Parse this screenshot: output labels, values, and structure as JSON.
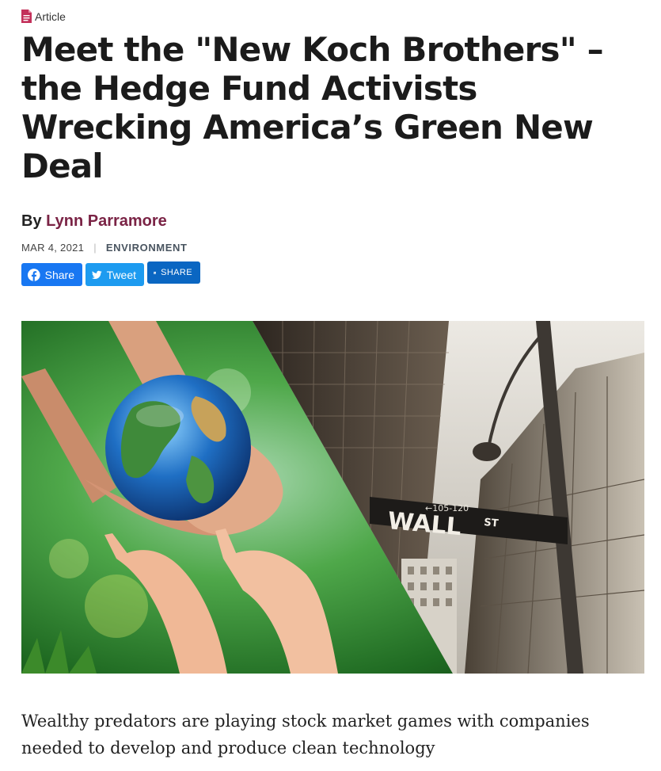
{
  "header": {
    "tag_label": "Article",
    "title": "Meet the \"New Koch Brothers\" – the Hedge Fund Activists Wrecking America’s Green New Deal"
  },
  "byline": {
    "prefix": "By",
    "author": "Lynn Parramore"
  },
  "meta": {
    "date": "MAR 4, 2021",
    "separator": "|",
    "category": "ENVIRONMENT"
  },
  "share": {
    "facebook_label": "Share",
    "twitter_label": "Tweet",
    "linkedin_label": "SHARE"
  },
  "hero": {
    "sign_main": "WALL",
    "sign_suffix": "ST",
    "sign_numbers": "←105-120"
  },
  "dek": "Wealthy predators are playing stock market games with companies needed to develop and produce clean technology",
  "colors": {
    "author": "#7a2345",
    "facebook": "#1877f2",
    "twitter": "#1d9bf0",
    "linkedin": "#0a66c2",
    "tag_icon": "#c3305a"
  }
}
